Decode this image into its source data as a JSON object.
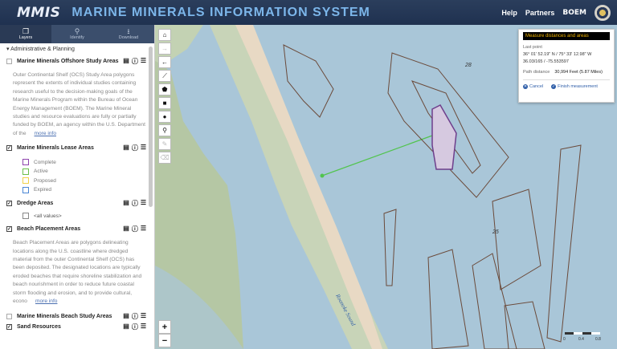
{
  "header": {
    "logo": "MMIS",
    "title": "MARINE MINERALS INFORMATION SYSTEM",
    "nav": [
      "Help",
      "Partners"
    ],
    "partner_logo": "BOEM"
  },
  "sidebar": {
    "tabs": [
      {
        "label": "Layers",
        "icon": "layers-icon",
        "active": true
      },
      {
        "label": "Identify",
        "icon": "search-icon",
        "active": false
      },
      {
        "label": "Download",
        "icon": "download-icon",
        "active": false
      }
    ],
    "group_title": "Administrative & Planning",
    "layers": [
      {
        "name": "Marine Minerals Offshore Study Areas",
        "checked": false,
        "description": "Outer Continental Shelf (OCS) Study Area polygons represent the extents of individual studies containing research useful to the decision-making goals of the Marine Minerals Program within the Bureau of Ocean Energy Management (BOEM). The Marine Mineral studies and resource evaluations are fully or partially funded by BOEM, an agency within the U.S. Department of the",
        "more": "more info"
      },
      {
        "name": "Marine Minerals Lease Areas",
        "checked": true,
        "legend": [
          {
            "label": "Complete",
            "color": "#8e44ad"
          },
          {
            "label": "Active",
            "color": "#6abf4b"
          },
          {
            "label": "Proposed",
            "color": "#f0d04a"
          },
          {
            "label": "Expired",
            "color": "#4a86d4"
          }
        ]
      },
      {
        "name": "Dredge Areas",
        "checked": true,
        "all_values": "<all values>"
      },
      {
        "name": "Beach Placement Areas",
        "checked": true,
        "description": "Beach Placement Areas are polygons delineating locations along the U.S. coastline where dredged material from the outer Continental Shelf (OCS) has been deposited. The designated locations are typically eroded beaches that require shoreline stabilization and beach nourishment in order to reduce future coastal storm flooding and erosion, and to provide cultural, econo",
        "more": "more info"
      },
      {
        "name": "Marine Minerals Beach Study Areas",
        "checked": false
      },
      {
        "name": "Sand Resources",
        "checked": true
      }
    ]
  },
  "map": {
    "labels": [
      "28",
      "25",
      "Roanoke Sound"
    ],
    "water_color": "#a9c6d8",
    "land_color": "#b5c7a4",
    "measure_line_color": "#52c44e",
    "scale": [
      "0",
      "0.4",
      "0.8"
    ]
  },
  "measure": {
    "title": "Measure distances and areas",
    "last_point_label": "Last point",
    "dms": "36° 01' 52.19\" N / 75° 33' 12.98\" W",
    "decimal": "36.03/165 / -75.553597",
    "distance_label": "Path distance",
    "distance_value": "30,994 Feet (5.87 Miles)",
    "cancel": "Cancel",
    "finish": "Finish measurement"
  }
}
